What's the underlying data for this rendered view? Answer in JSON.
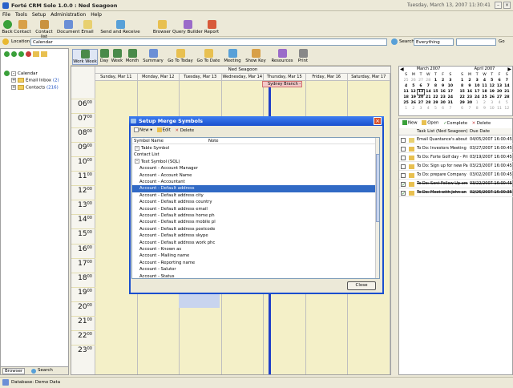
{
  "window": {
    "title": "Forté CRM Solo 1.0.0 : Ned Seagoon",
    "date": "Tuesday, March 13, 2007 11:30:41"
  },
  "menu": [
    "File",
    "Tools",
    "Setup",
    "Administration",
    "Help"
  ],
  "toolbar": [
    "Back",
    "Contact",
    "Contact list",
    "Document",
    "Email",
    "Send and Receive",
    "Browser",
    "Query Builder",
    "Report"
  ],
  "location": {
    "label": "Location",
    "value": "Calendar"
  },
  "search": {
    "label": "Search",
    "scope": "Everything",
    "value": "",
    "go": "Go"
  },
  "tree": [
    {
      "label": "Calendar",
      "count": ""
    },
    {
      "label": "Email Inbox",
      "count": "(2)"
    },
    {
      "label": "Contacts",
      "count": "(216)"
    }
  ],
  "left_tabs": [
    "Browser",
    "Search"
  ],
  "cal_toolbar": [
    "Work Week",
    "Day",
    "Week",
    "Month",
    "Summary",
    "Go To Today",
    "Go To Date",
    "Meeting",
    "Show Key",
    "Resources",
    "Print"
  ],
  "calendar": {
    "owner": "Ned Seagoon",
    "days": [
      "Sunday, Mar 11",
      "Monday, Mar 12",
      "Tuesday, Mar 13",
      "Wednesday, Mar 14",
      "Thursday, Mar 15",
      "Friday, Mar 16",
      "Saturday, Mar 17"
    ],
    "event": "Sydney Branch -",
    "hours": [
      "06",
      "07",
      "08",
      "09",
      "10",
      "11",
      "12",
      "13",
      "14",
      "15",
      "16",
      "17",
      "18",
      "19",
      "20",
      "21",
      "22",
      "23"
    ],
    "minutes": "00"
  },
  "dialog": {
    "title": "Setup Merge Symbols",
    "toolbar": [
      "New",
      "Edit",
      "Delete"
    ],
    "columns": [
      "Symbol Name",
      "Note"
    ],
    "items": [
      {
        "label": "Table Symbol",
        "kind": "group"
      },
      {
        "label": "Contact List",
        "kind": "plain"
      },
      {
        "label": "Text Symbol (SQL)",
        "kind": "group"
      },
      {
        "label": "Account - Account Manager",
        "kind": "item"
      },
      {
        "label": "Account - Account Name",
        "kind": "item"
      },
      {
        "label": "Account - Accountant",
        "kind": "item"
      },
      {
        "label": "Account - Default address",
        "kind": "selected"
      },
      {
        "label": "Account - Default address city",
        "kind": "item"
      },
      {
        "label": "Account - Default address country",
        "kind": "item"
      },
      {
        "label": "Account - Default address email",
        "kind": "item"
      },
      {
        "label": "Account - Default address home ph",
        "kind": "item"
      },
      {
        "label": "Account - Default address mobile pl",
        "kind": "item"
      },
      {
        "label": "Account - Default address postcode",
        "kind": "item"
      },
      {
        "label": "Account - Default address skype",
        "kind": "item"
      },
      {
        "label": "Account - Default address work phc",
        "kind": "item"
      },
      {
        "label": "Account - Known as",
        "kind": "item"
      },
      {
        "label": "Account - Mailing name",
        "kind": "item"
      },
      {
        "label": "Account - Reporting name",
        "kind": "item"
      },
      {
        "label": "Account - Salutor",
        "kind": "item"
      },
      {
        "label": "Account - Status",
        "kind": "item"
      }
    ],
    "close": "Close"
  },
  "minicals": [
    {
      "title": "March 2007",
      "dow": [
        "S",
        "M",
        "T",
        "W",
        "T",
        "F",
        "S"
      ],
      "rows": [
        [
          "25",
          "26",
          "27",
          "28",
          "1",
          "2",
          "3"
        ],
        [
          "4",
          "5",
          "6",
          "7",
          "8",
          "9",
          "10"
        ],
        [
          "11",
          "12",
          "13",
          "14",
          "15",
          "16",
          "17"
        ],
        [
          "18",
          "19",
          "20",
          "21",
          "22",
          "23",
          "24"
        ],
        [
          "25",
          "26",
          "27",
          "28",
          "29",
          "30",
          "31"
        ],
        [
          "1",
          "2",
          "3",
          "4",
          "5",
          "6",
          "7"
        ]
      ]
    },
    {
      "title": "April 2007",
      "dow": [
        "S",
        "M",
        "T",
        "W",
        "T",
        "F",
        "S"
      ],
      "rows": [
        [
          "1",
          "2",
          "3",
          "4",
          "5",
          "6",
          "7"
        ],
        [
          "8",
          "9",
          "10",
          "11",
          "12",
          "13",
          "14"
        ],
        [
          "15",
          "16",
          "17",
          "18",
          "19",
          "20",
          "21"
        ],
        [
          "22",
          "23",
          "24",
          "25",
          "26",
          "27",
          "28"
        ],
        [
          "29",
          "30",
          "1",
          "2",
          "3",
          "4",
          "5"
        ],
        [
          "6",
          "7",
          "8",
          "9",
          "10",
          "11",
          "12"
        ]
      ]
    }
  ],
  "tasks": {
    "toolbar": [
      "New",
      "Open",
      "Complete",
      "Delete"
    ],
    "columns": [
      "Task List (Ned Seagoon)",
      "Due Date"
    ],
    "rows": [
      {
        "task": "Email Quantance's about t",
        "due": "04/05/2007 16:00:45",
        "done": false
      },
      {
        "task": "To Do: Investors Meeting",
        "due": "03/27/2007 16:00:45",
        "done": false
      },
      {
        "task": "To Do: Forte Golf day - Pri",
        "due": "03/19/2007 16:00:45",
        "done": false
      },
      {
        "task": "To Do: Sign up for new Pa",
        "due": "03/23/2007 16:00:45",
        "done": false
      },
      {
        "task": "To Do: prepare Company (",
        "due": "03/02/2007 16:00:45",
        "done": false
      },
      {
        "task": "To Do: Sent Follow Up em",
        "due": "03/22/2007 16:00:45",
        "done": true
      },
      {
        "task": "To Do: Meet with John an",
        "due": "02/26/2007 16:00:35",
        "done": true
      }
    ]
  },
  "status": "Database: Demo Data"
}
